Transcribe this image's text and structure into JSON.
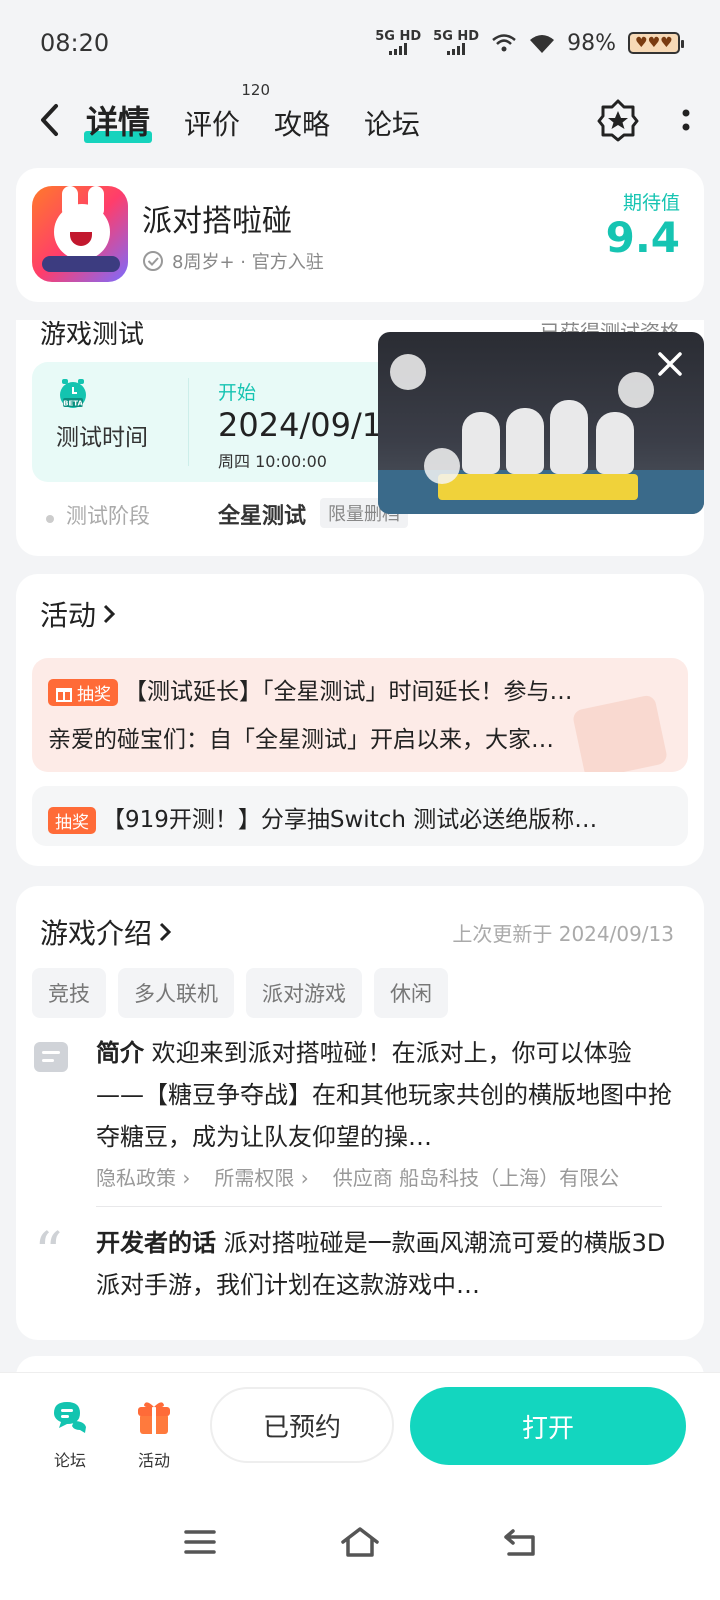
{
  "status_bar": {
    "time": "08:20",
    "sim1_label": "5G HD",
    "sim2_label": "5G HD",
    "battery_percent": "98%",
    "battery_icon": "heart-battery-icon"
  },
  "nav": {
    "tabs": [
      {
        "label": "详情",
        "active": true
      },
      {
        "label": "评价",
        "count": "120"
      },
      {
        "label": "攻略"
      },
      {
        "label": "论坛"
      }
    ],
    "icons": [
      "back-arrow-icon",
      "star-badge-icon",
      "more-vertical-icon"
    ]
  },
  "game": {
    "title": "派对搭啦碰",
    "meta": "8周岁+ · 官方入驻",
    "expect_label": "期待值",
    "expect_value": "9.4"
  },
  "test": {
    "title": "游戏测试",
    "right_label": "已获得测试资格",
    "time_label": "测试时间",
    "start_label": "开始",
    "start_date": "2024/09/1",
    "start_week": "周四  10:00:00",
    "stage_label": "测试阶段",
    "stage_value": "全星测试",
    "stage_tag": "限量删档"
  },
  "activity": {
    "title": "活动",
    "items": [
      {
        "tag": "抽奖",
        "headline": "【测试延长】「全星测试」时间延长！参与…",
        "desc": "亲爱的碰宝们：自「全星测试」开启以来，大家…"
      },
      {
        "tag": "抽奖",
        "headline": "【919开测！】分享抽Switch 测试必送绝版称…"
      }
    ]
  },
  "intro": {
    "title": "游戏介绍",
    "updated": "上次更新于 2024/09/13",
    "tags": [
      "竞技",
      "多人联机",
      "派对游戏",
      "休闲"
    ],
    "summary_label": "简介",
    "summary": "欢迎来到派对搭啦碰！在派对上，你可以体验——【糖豆争夺战】在和其他玩家共创的横版地图中抢夺糖豆，成为让队友仰望的操…",
    "links": [
      "隐私政策 ›",
      "所需权限 ›",
      "供应商 船岛科技（上海）有限公"
    ],
    "dev_label": "开发者的话",
    "dev_text": "派对搭啦碰是一款画风潮流可爱的横版3D派对手游，我们计划在这款游戏中…"
  },
  "bottom_bar": {
    "forum_label": "论坛",
    "activity_label": "活动",
    "reserved_label": "已预约",
    "open_label": "打开",
    "accent": "#13d6bf"
  },
  "system_nav": [
    "menu-icon",
    "home-icon",
    "back-icon"
  ]
}
